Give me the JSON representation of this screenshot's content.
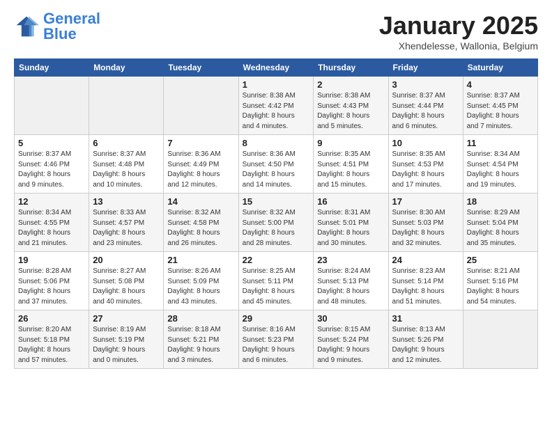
{
  "header": {
    "logo_general": "General",
    "logo_blue": "Blue",
    "month": "January 2025",
    "location": "Xhendelesse, Wallonia, Belgium"
  },
  "weekdays": [
    "Sunday",
    "Monday",
    "Tuesday",
    "Wednesday",
    "Thursday",
    "Friday",
    "Saturday"
  ],
  "weeks": [
    [
      {
        "day": "",
        "info": ""
      },
      {
        "day": "",
        "info": ""
      },
      {
        "day": "",
        "info": ""
      },
      {
        "day": "1",
        "info": "Sunrise: 8:38 AM\nSunset: 4:42 PM\nDaylight: 8 hours\nand 4 minutes."
      },
      {
        "day": "2",
        "info": "Sunrise: 8:38 AM\nSunset: 4:43 PM\nDaylight: 8 hours\nand 5 minutes."
      },
      {
        "day": "3",
        "info": "Sunrise: 8:37 AM\nSunset: 4:44 PM\nDaylight: 8 hours\nand 6 minutes."
      },
      {
        "day": "4",
        "info": "Sunrise: 8:37 AM\nSunset: 4:45 PM\nDaylight: 8 hours\nand 7 minutes."
      }
    ],
    [
      {
        "day": "5",
        "info": "Sunrise: 8:37 AM\nSunset: 4:46 PM\nDaylight: 8 hours\nand 9 minutes."
      },
      {
        "day": "6",
        "info": "Sunrise: 8:37 AM\nSunset: 4:48 PM\nDaylight: 8 hours\nand 10 minutes."
      },
      {
        "day": "7",
        "info": "Sunrise: 8:36 AM\nSunset: 4:49 PM\nDaylight: 8 hours\nand 12 minutes."
      },
      {
        "day": "8",
        "info": "Sunrise: 8:36 AM\nSunset: 4:50 PM\nDaylight: 8 hours\nand 14 minutes."
      },
      {
        "day": "9",
        "info": "Sunrise: 8:35 AM\nSunset: 4:51 PM\nDaylight: 8 hours\nand 15 minutes."
      },
      {
        "day": "10",
        "info": "Sunrise: 8:35 AM\nSunset: 4:53 PM\nDaylight: 8 hours\nand 17 minutes."
      },
      {
        "day": "11",
        "info": "Sunrise: 8:34 AM\nSunset: 4:54 PM\nDaylight: 8 hours\nand 19 minutes."
      }
    ],
    [
      {
        "day": "12",
        "info": "Sunrise: 8:34 AM\nSunset: 4:55 PM\nDaylight: 8 hours\nand 21 minutes."
      },
      {
        "day": "13",
        "info": "Sunrise: 8:33 AM\nSunset: 4:57 PM\nDaylight: 8 hours\nand 23 minutes."
      },
      {
        "day": "14",
        "info": "Sunrise: 8:32 AM\nSunset: 4:58 PM\nDaylight: 8 hours\nand 26 minutes."
      },
      {
        "day": "15",
        "info": "Sunrise: 8:32 AM\nSunset: 5:00 PM\nDaylight: 8 hours\nand 28 minutes."
      },
      {
        "day": "16",
        "info": "Sunrise: 8:31 AM\nSunset: 5:01 PM\nDaylight: 8 hours\nand 30 minutes."
      },
      {
        "day": "17",
        "info": "Sunrise: 8:30 AM\nSunset: 5:03 PM\nDaylight: 8 hours\nand 32 minutes."
      },
      {
        "day": "18",
        "info": "Sunrise: 8:29 AM\nSunset: 5:04 PM\nDaylight: 8 hours\nand 35 minutes."
      }
    ],
    [
      {
        "day": "19",
        "info": "Sunrise: 8:28 AM\nSunset: 5:06 PM\nDaylight: 8 hours\nand 37 minutes."
      },
      {
        "day": "20",
        "info": "Sunrise: 8:27 AM\nSunset: 5:08 PM\nDaylight: 8 hours\nand 40 minutes."
      },
      {
        "day": "21",
        "info": "Sunrise: 8:26 AM\nSunset: 5:09 PM\nDaylight: 8 hours\nand 43 minutes."
      },
      {
        "day": "22",
        "info": "Sunrise: 8:25 AM\nSunset: 5:11 PM\nDaylight: 8 hours\nand 45 minutes."
      },
      {
        "day": "23",
        "info": "Sunrise: 8:24 AM\nSunset: 5:13 PM\nDaylight: 8 hours\nand 48 minutes."
      },
      {
        "day": "24",
        "info": "Sunrise: 8:23 AM\nSunset: 5:14 PM\nDaylight: 8 hours\nand 51 minutes."
      },
      {
        "day": "25",
        "info": "Sunrise: 8:21 AM\nSunset: 5:16 PM\nDaylight: 8 hours\nand 54 minutes."
      }
    ],
    [
      {
        "day": "26",
        "info": "Sunrise: 8:20 AM\nSunset: 5:18 PM\nDaylight: 8 hours\nand 57 minutes."
      },
      {
        "day": "27",
        "info": "Sunrise: 8:19 AM\nSunset: 5:19 PM\nDaylight: 9 hours\nand 0 minutes."
      },
      {
        "day": "28",
        "info": "Sunrise: 8:18 AM\nSunset: 5:21 PM\nDaylight: 9 hours\nand 3 minutes."
      },
      {
        "day": "29",
        "info": "Sunrise: 8:16 AM\nSunset: 5:23 PM\nDaylight: 9 hours\nand 6 minutes."
      },
      {
        "day": "30",
        "info": "Sunrise: 8:15 AM\nSunset: 5:24 PM\nDaylight: 9 hours\nand 9 minutes."
      },
      {
        "day": "31",
        "info": "Sunrise: 8:13 AM\nSunset: 5:26 PM\nDaylight: 9 hours\nand 12 minutes."
      },
      {
        "day": "",
        "info": ""
      }
    ]
  ]
}
